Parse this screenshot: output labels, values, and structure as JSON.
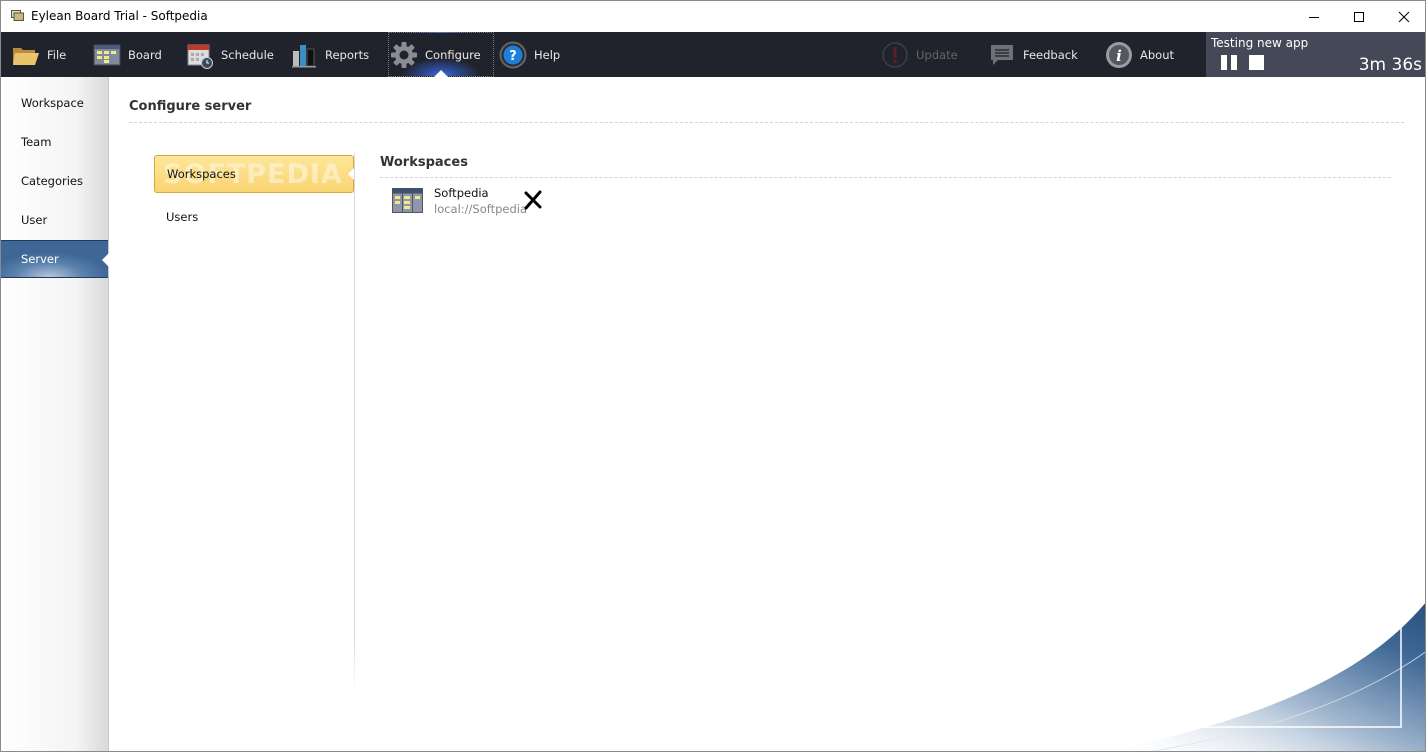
{
  "window": {
    "title": "Eylean Board Trial - Softpedia",
    "controls": {
      "minimize": "minimize",
      "maximize": "maximize",
      "close": "close"
    }
  },
  "toolbar": {
    "items": [
      {
        "label": "File",
        "icon": "folder-icon"
      },
      {
        "label": "Board",
        "icon": "board-icon"
      },
      {
        "label": "Schedule",
        "icon": "calendar-icon"
      },
      {
        "label": "Reports",
        "icon": "bar-chart-icon"
      },
      {
        "label": "Configure",
        "icon": "gear-icon",
        "active": true
      },
      {
        "label": "Help",
        "icon": "help-icon"
      },
      {
        "label": "Update",
        "icon": "alert-icon",
        "disabled": true
      },
      {
        "label": "Feedback",
        "icon": "speech-bubble-icon"
      },
      {
        "label": "About",
        "icon": "info-icon"
      }
    ]
  },
  "timer": {
    "label": "Testing new app",
    "elapsed": "3m 36s"
  },
  "sidebar": {
    "items": [
      {
        "label": "Workspace"
      },
      {
        "label": "Team"
      },
      {
        "label": "Categories"
      },
      {
        "label": "User"
      },
      {
        "label": "Server",
        "active": true
      }
    ]
  },
  "content": {
    "title": "Configure server",
    "subnav": {
      "watermark": "SOFTPEDIA",
      "items": [
        {
          "label": "Workspaces",
          "active": true
        },
        {
          "label": "Users"
        }
      ]
    },
    "section_title": "Workspaces",
    "workspaces": [
      {
        "name": "Softpedia",
        "path": "local://Softpedia"
      }
    ]
  },
  "colors": {
    "toolbar_bg": "#21232c",
    "timer_bg": "#454856",
    "sidebar_active": "#3e6795",
    "subnav_active": "#f9d472"
  }
}
